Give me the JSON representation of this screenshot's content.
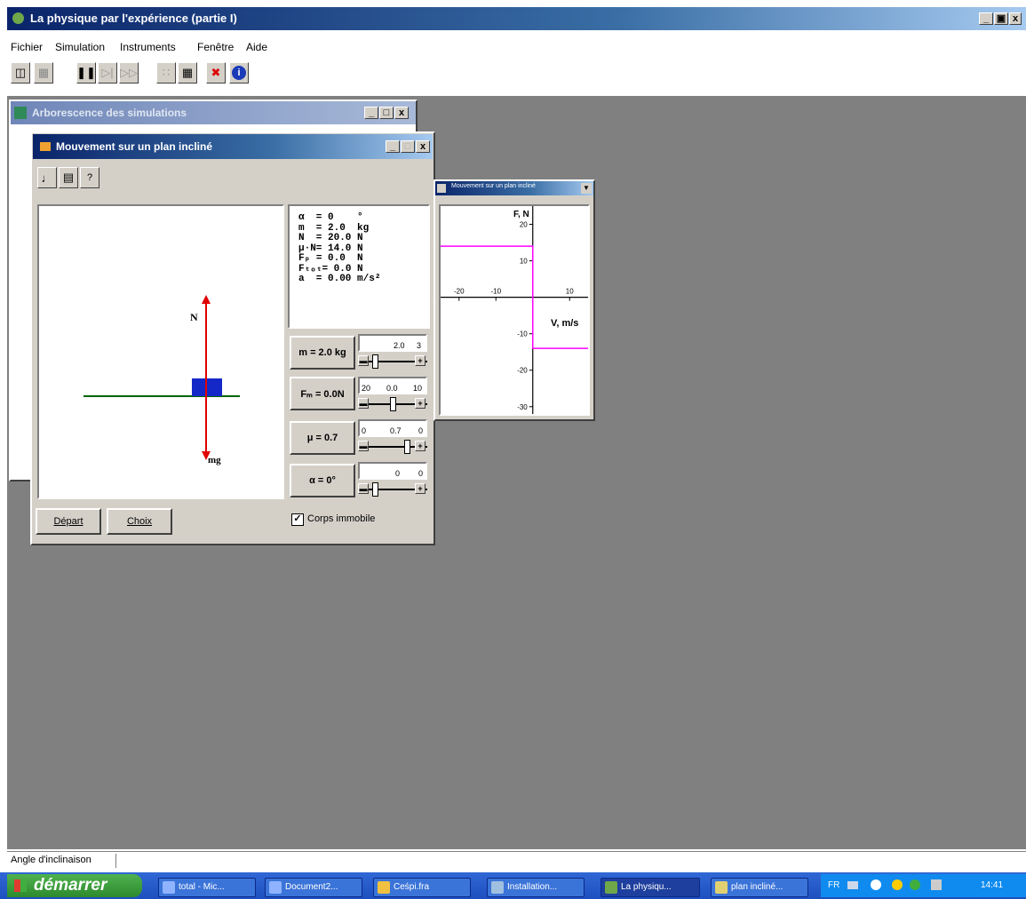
{
  "app": {
    "title": "La physique par l'expérience (partie I)",
    "window_controls": [
      "_",
      "ɑ",
      "x"
    ]
  },
  "menu": [
    "Fichier",
    "Simulation",
    "Instruments",
    "Fenêtre",
    "Aide"
  ],
  "tree_window": {
    "title": "Arborescence des simulations"
  },
  "sim_window": {
    "title": "Mouvement sur un plan incliné",
    "readouts": [
      "α  = 0    °",
      "m  = 2.0  kg",
      "N  = 20.0 N",
      "μ·N= 14.0 N",
      "Fₚ = 0.0  N",
      "Fₜₒₜ= 0.0 N",
      "a  = 0.00 m/s²"
    ],
    "force_labels": {
      "normal": "N",
      "weight": "mg"
    },
    "params": [
      {
        "label": "m = 2.0 kg",
        "scale": [
          "",
          "2.0",
          "3"
        ]
      },
      {
        "label": "Fₘ = 0.0N",
        "scale": [
          "20",
          "0.0",
          "10"
        ]
      },
      {
        "label": "μ = 0.7",
        "scale": [
          "0",
          "0.7",
          "0"
        ]
      },
      {
        "label": "α = 0°",
        "scale": [
          "",
          "0",
          "0"
        ]
      }
    ],
    "buttons": {
      "start": "Départ",
      "choice": "Choix"
    },
    "checkbox": {
      "label": "Corps immobile",
      "checked": true
    }
  },
  "graph_window": {
    "title": "Mouvement sur un plan incliné",
    "y_label": "F, N",
    "x_label": "V, m/s",
    "y_ticks": [
      "20",
      "10",
      "-10",
      "-20",
      "-30"
    ],
    "x_ticks": [
      "-20",
      "-10",
      "10"
    ]
  },
  "status_bar": {
    "text": "Angle d'inclinaison"
  },
  "taskbar": {
    "start_label": "démarrer",
    "items": [
      "total - Mic...",
      "Document2...",
      "Ceśpi.fra",
      "Installation...",
      "La physiqu...",
      "plan incliné...",
      ""
    ],
    "tray_lang": "FR",
    "clock": "14:41"
  },
  "colors": {
    "titlebar": "#0a246a",
    "desktop_gray": "#808080",
    "force_arrow": "#e00000",
    "graph_line": "#ff00ff",
    "block": "#1428c8",
    "ground": "#006400",
    "taskbar": "#245edb",
    "start": "#3c9a3c"
  },
  "chart_data": {
    "type": "line",
    "xlabel": "V, m/s",
    "ylabel": "F, N",
    "xlim": [
      -25,
      15
    ],
    "ylim": [
      -32,
      25
    ],
    "series": [
      {
        "x": [
          -25,
          0,
          0,
          0,
          15
        ],
        "y": [
          14,
          14,
          0,
          -14,
          -14
        ]
      }
    ]
  }
}
